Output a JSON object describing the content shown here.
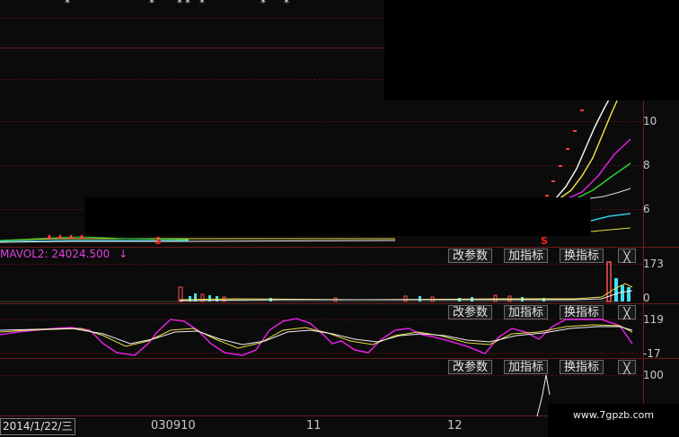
{
  "axis": {
    "price": [
      "10",
      "8",
      "6"
    ],
    "volume": [
      "173",
      "0"
    ],
    "osc": [
      "119",
      "-17"
    ],
    "bottom": [
      "100"
    ]
  },
  "indicator": {
    "mavol_label": "MAVOL2: 24024.500",
    "mavol_arrow": "↓"
  },
  "panel_buttons": {
    "change_params": "改参数",
    "add_indicator": "加指标",
    "switch_indicator": "换指标",
    "close": "╳"
  },
  "signals": {
    "sell": "S"
  },
  "top_markers": [
    "*",
    "*",
    "*",
    "*",
    "*",
    "*",
    "*"
  ],
  "xaxis": {
    "date": "2014/1/22/三",
    "ticks": [
      "030910",
      "11",
      "12"
    ]
  },
  "watermark": "www.7gpzb.com",
  "colors": {
    "background": "#0b0b0b",
    "grid": "#6a1a1a",
    "ma_white": "#f0f0f0",
    "ma_yellow": "#e8e040",
    "ma_magenta": "#e020e0",
    "ma_green": "#30d030",
    "ma_cyan": "#30c8e0",
    "vol_red": "#ff5050",
    "vol_cyan": "#40e0f0"
  }
}
